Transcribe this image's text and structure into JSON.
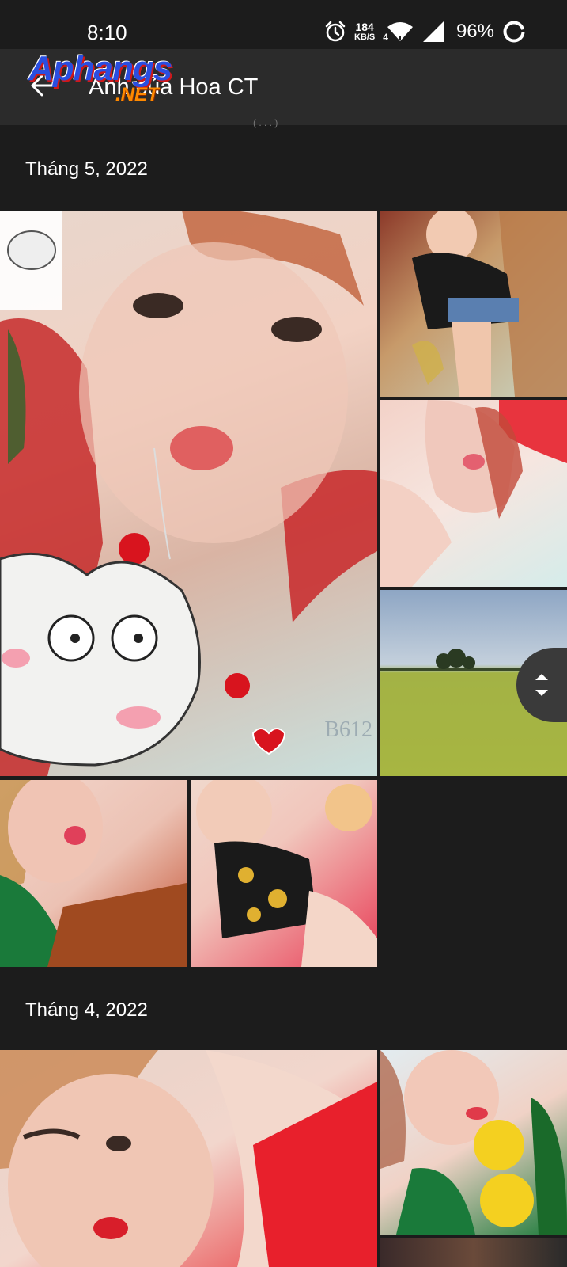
{
  "status_bar": {
    "time": "8:10",
    "net_speed_value": "184",
    "net_speed_unit": "KB/S",
    "network_type": "4",
    "battery_percent": "96%"
  },
  "app_bar": {
    "title": "Ảnh của Hoa CT",
    "watermark_main": "Aphangs",
    "watermark_suffix": ".NET",
    "partially_hidden_text": "( . . . )"
  },
  "sections": [
    {
      "month": "Tháng 5, 2022"
    },
    {
      "month": "Tháng 4, 2022"
    }
  ],
  "photos": [
    {
      "label": "Photo 1"
    },
    {
      "label": "Photo 2"
    },
    {
      "label": "Photo 3"
    },
    {
      "label": "Photo 4"
    },
    {
      "label": "Photo 5"
    },
    {
      "label": "Photo 6"
    },
    {
      "label": "Photo 7"
    },
    {
      "label": "Photo 8"
    },
    {
      "label": "Photo 9"
    }
  ],
  "photo1_stamp": "B612",
  "colors": {
    "background": "#1c1c1c",
    "app_bar": "#2b2b2b",
    "text": "#ffffff"
  },
  "icons": {
    "back": "arrow-left-icon",
    "alarm": "alarm-clock-icon",
    "wifi": "wifi-icon",
    "signal": "cell-signal-icon",
    "battery": "battery-ring-icon",
    "scroll": "scroll-handle-icon"
  }
}
